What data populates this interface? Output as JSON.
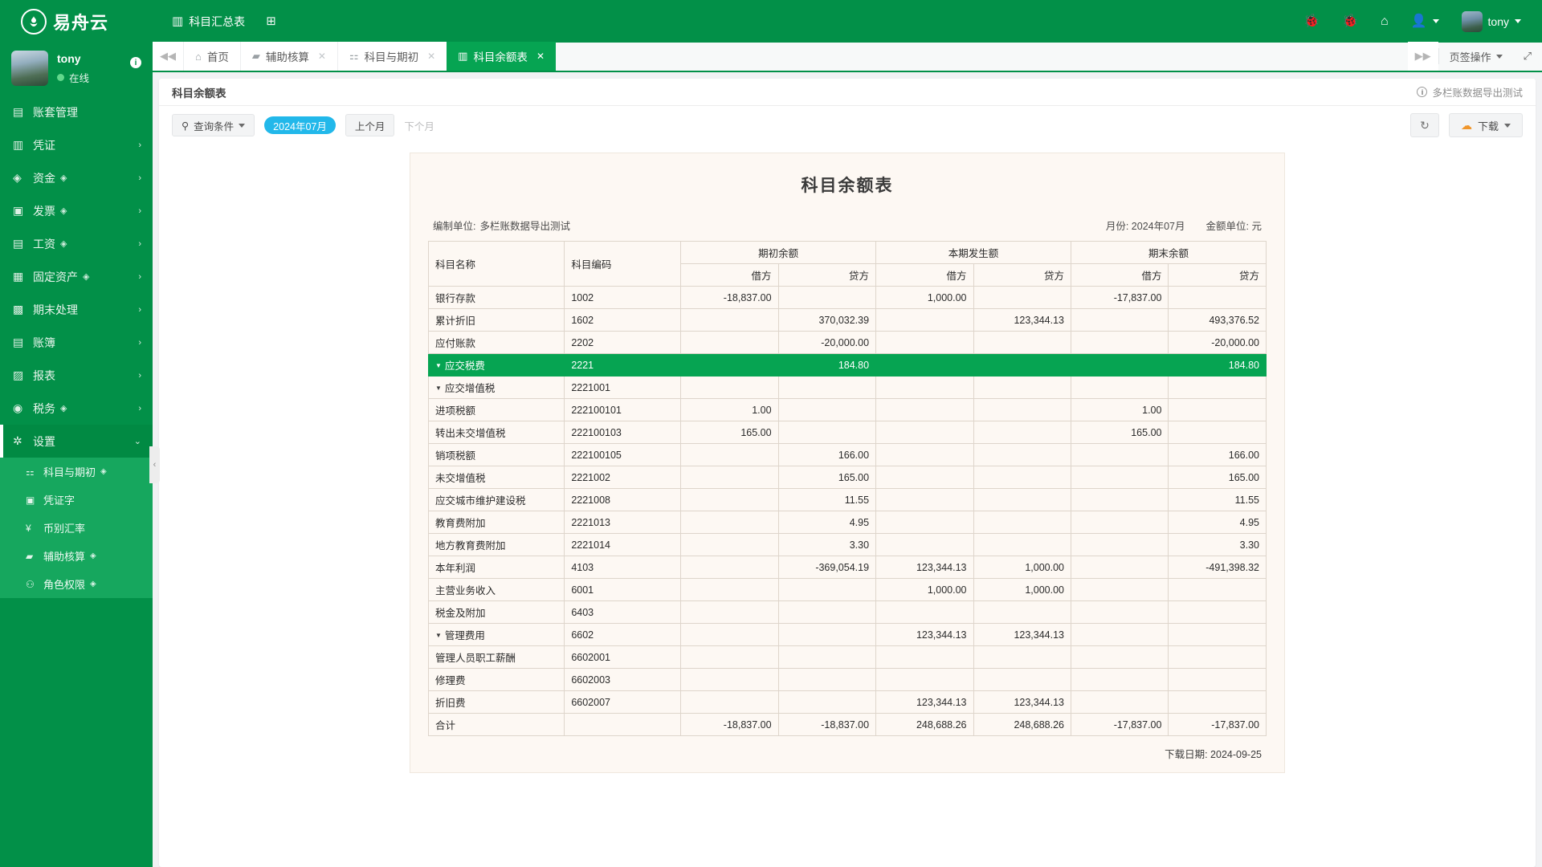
{
  "topbar": {
    "brand_name": "易舟云",
    "brand_logo_icon": "leaf-circle-icon",
    "menu": [
      {
        "label": "科目汇总表",
        "icon": "columns-icon"
      },
      {
        "label": "",
        "icon": "add-square-icon"
      }
    ],
    "icons": [
      "bug-icon",
      "bug-icon",
      "home-icon",
      "user-switch-icon"
    ],
    "user_name": "tony",
    "avatar_icon": "avatar"
  },
  "sidebar": {
    "user": {
      "name": "tony",
      "status": "在线",
      "info_badge": "i"
    },
    "items": [
      {
        "label": "账套管理",
        "icon": "account-book-icon",
        "chevron": "",
        "gem": false,
        "active": false
      },
      {
        "label": "凭证",
        "icon": "voucher-icon",
        "chevron": "›",
        "gem": false,
        "active": false
      },
      {
        "label": "资金",
        "icon": "funds-icon",
        "chevron": "›",
        "gem": true,
        "active": false
      },
      {
        "label": "发票",
        "icon": "invoice-icon",
        "chevron": "›",
        "gem": true,
        "active": false
      },
      {
        "label": "工资",
        "icon": "salary-icon",
        "chevron": "›",
        "gem": true,
        "active": false
      },
      {
        "label": "固定资产",
        "icon": "asset-icon",
        "chevron": "›",
        "gem": true,
        "active": false
      },
      {
        "label": "期末处理",
        "icon": "calendar-icon",
        "chevron": "›",
        "gem": false,
        "active": false
      },
      {
        "label": "账簿",
        "icon": "ledger-icon",
        "chevron": "›",
        "gem": false,
        "active": false
      },
      {
        "label": "报表",
        "icon": "chart-icon",
        "chevron": "›",
        "gem": false,
        "active": false
      },
      {
        "label": "税务",
        "icon": "tax-icon",
        "chevron": "›",
        "gem": true,
        "active": false
      },
      {
        "label": "设置",
        "icon": "gear-icon",
        "chevron": "⌄",
        "gem": false,
        "active": true
      }
    ],
    "submenu": [
      {
        "label": "科目与期初",
        "icon": "subject-icon",
        "gem": true
      },
      {
        "label": "凭证字",
        "icon": "voucher-word-icon",
        "gem": false
      },
      {
        "label": "币别汇率",
        "icon": "yen-icon",
        "gem": false
      },
      {
        "label": "辅助核算",
        "icon": "folder-icon",
        "gem": true
      },
      {
        "label": "角色权限",
        "icon": "roles-icon",
        "gem": true
      }
    ],
    "collapse_handle_icon": "chevron-left-icon"
  },
  "tabstrip": {
    "prev_icon": "double-chevron-left-icon",
    "next_icon": "double-chevron-right-icon",
    "tabs": [
      {
        "label": "首页",
        "icon": "home-icon",
        "closable": false,
        "active": false
      },
      {
        "label": "辅助核算",
        "icon": "folder-icon",
        "closable": true,
        "active": false
      },
      {
        "label": "科目与期初",
        "icon": "subject-icon",
        "closable": true,
        "active": false
      },
      {
        "label": "科目余额表",
        "icon": "columns-icon",
        "closable": true,
        "active": true
      }
    ],
    "tab_action_label": "页签操作",
    "fullscreen_icon": "fullscreen-icon"
  },
  "panel": {
    "title": "科目余额表",
    "org_note": "多栏账数据导出测试",
    "info_icon": "info-icon"
  },
  "toolbar": {
    "query_label": "查询条件",
    "query_icon": "search-icon",
    "period_pill": "2024年07月",
    "prev_month": "上个月",
    "next_month": "下个月",
    "refresh_icon": "refresh-icon",
    "download_label": "下载",
    "download_icon": "cloud-download-icon"
  },
  "report": {
    "title": "科目余额表",
    "org_label": "编制单位:",
    "org_value": "多栏账数据导出测试",
    "period_label": "月份:",
    "period_value": "2024年07月",
    "unit_label": "金额单位:",
    "unit_value": "元",
    "download_date_label": "下载日期:",
    "download_date_value": "2024-09-25",
    "group_headers": [
      "科目名称",
      "科目编码",
      "期初余额",
      "本期发生额",
      "期末余额"
    ],
    "sub_headers": [
      "借方",
      "贷方",
      "借方",
      "贷方",
      "借方",
      "贷方"
    ],
    "rows": [
      {
        "name": "银行存款",
        "code": "1002",
        "indent": 0,
        "expandable": false,
        "highlight": false,
        "cells": [
          "-18,837.00",
          "",
          "1,000.00",
          "",
          "-17,837.00",
          ""
        ],
        "neg": [
          true,
          false,
          false,
          false,
          true,
          false
        ]
      },
      {
        "name": "累计折旧",
        "code": "1602",
        "indent": 0,
        "expandable": false,
        "highlight": false,
        "cells": [
          "",
          "370,032.39",
          "",
          "123,344.13",
          "",
          "493,376.52"
        ],
        "neg": [
          false,
          false,
          false,
          false,
          false,
          false
        ]
      },
      {
        "name": "应付账款",
        "code": "2202",
        "indent": 0,
        "expandable": false,
        "highlight": false,
        "cells": [
          "",
          "-20,000.00",
          "",
          "",
          "",
          "-20,000.00"
        ],
        "neg": [
          false,
          true,
          false,
          false,
          false,
          true
        ]
      },
      {
        "name": "应交税费",
        "code": "2221",
        "indent": 0,
        "expandable": true,
        "highlight": true,
        "cells": [
          "",
          "184.80",
          "",
          "",
          "",
          "184.80"
        ],
        "neg": [
          false,
          false,
          false,
          false,
          false,
          false
        ]
      },
      {
        "name": "应交增值税",
        "code": "2221001",
        "indent": 1,
        "expandable": true,
        "highlight": false,
        "cells": [
          "",
          "",
          "",
          "",
          "",
          ""
        ],
        "neg": [
          false,
          false,
          false,
          false,
          false,
          false
        ]
      },
      {
        "name": "进项税额",
        "code": "222100101",
        "indent": 2,
        "expandable": false,
        "highlight": false,
        "cells": [
          "1.00",
          "",
          "",
          "",
          "1.00",
          ""
        ],
        "neg": [
          false,
          false,
          false,
          false,
          false,
          false
        ]
      },
      {
        "name": "转出未交增值税",
        "code": "222100103",
        "indent": 2,
        "expandable": false,
        "highlight": false,
        "cells": [
          "165.00",
          "",
          "",
          "",
          "165.00",
          ""
        ],
        "neg": [
          false,
          false,
          false,
          false,
          false,
          false
        ]
      },
      {
        "name": "销项税额",
        "code": "222100105",
        "indent": 2,
        "expandable": false,
        "highlight": false,
        "cells": [
          "",
          "166.00",
          "",
          "",
          "",
          "166.00"
        ],
        "neg": [
          false,
          false,
          false,
          false,
          false,
          false
        ]
      },
      {
        "name": "未交增值税",
        "code": "2221002",
        "indent": 1,
        "expandable": false,
        "highlight": false,
        "cells": [
          "",
          "165.00",
          "",
          "",
          "",
          "165.00"
        ],
        "neg": [
          false,
          false,
          false,
          false,
          false,
          false
        ]
      },
      {
        "name": "应交城市维护建设税",
        "code": "2221008",
        "indent": 1,
        "expandable": false,
        "highlight": false,
        "cells": [
          "",
          "11.55",
          "",
          "",
          "",
          "11.55"
        ],
        "neg": [
          false,
          false,
          false,
          false,
          false,
          false
        ]
      },
      {
        "name": "教育费附加",
        "code": "2221013",
        "indent": 1,
        "expandable": false,
        "highlight": false,
        "cells": [
          "",
          "4.95",
          "",
          "",
          "",
          "4.95"
        ],
        "neg": [
          false,
          false,
          false,
          false,
          false,
          false
        ]
      },
      {
        "name": "地方教育费附加",
        "code": "2221014",
        "indent": 1,
        "expandable": false,
        "highlight": false,
        "cells": [
          "",
          "3.30",
          "",
          "",
          "",
          "3.30"
        ],
        "neg": [
          false,
          false,
          false,
          false,
          false,
          false
        ]
      },
      {
        "name": "本年利润",
        "code": "4103",
        "indent": 0,
        "expandable": false,
        "highlight": false,
        "cells": [
          "",
          "-369,054.19",
          "123,344.13",
          "1,000.00",
          "",
          "-491,398.32"
        ],
        "neg": [
          false,
          true,
          false,
          false,
          false,
          true
        ]
      },
      {
        "name": "主营业务收入",
        "code": "6001",
        "indent": 0,
        "expandable": false,
        "highlight": false,
        "cells": [
          "",
          "",
          "1,000.00",
          "1,000.00",
          "",
          ""
        ],
        "neg": [
          false,
          false,
          false,
          false,
          false,
          false
        ]
      },
      {
        "name": "税金及附加",
        "code": "6403",
        "indent": 0,
        "expandable": false,
        "highlight": false,
        "cells": [
          "",
          "",
          "",
          "",
          "",
          ""
        ],
        "neg": [
          false,
          false,
          false,
          false,
          false,
          false
        ]
      },
      {
        "name": "管理费用",
        "code": "6602",
        "indent": 0,
        "expandable": true,
        "highlight": false,
        "cells": [
          "",
          "",
          "123,344.13",
          "123,344.13",
          "",
          ""
        ],
        "neg": [
          false,
          false,
          false,
          false,
          false,
          false
        ]
      },
      {
        "name": "管理人员职工薪酬",
        "code": "6602001",
        "indent": 1,
        "expandable": false,
        "highlight": false,
        "cells": [
          "",
          "",
          "",
          "",
          "",
          ""
        ],
        "neg": [
          false,
          false,
          false,
          false,
          false,
          false
        ]
      },
      {
        "name": "修理费",
        "code": "6602003",
        "indent": 1,
        "expandable": false,
        "highlight": false,
        "cells": [
          "",
          "",
          "",
          "",
          "",
          ""
        ],
        "neg": [
          false,
          false,
          false,
          false,
          false,
          false
        ]
      },
      {
        "name": "折旧费",
        "code": "6602007",
        "indent": 1,
        "expandable": false,
        "highlight": false,
        "cells": [
          "",
          "",
          "123,344.13",
          "123,344.13",
          "",
          ""
        ],
        "neg": [
          false,
          false,
          false,
          false,
          false,
          false
        ]
      }
    ],
    "total_row": {
      "name": "合计",
      "code": "",
      "indent": 0,
      "cells": [
        "-18,837.00",
        "-18,837.00",
        "248,688.26",
        "248,688.26",
        "-17,837.00",
        "-17,837.00"
      ],
      "neg": [
        true,
        true,
        false,
        false,
        true,
        true
      ]
    }
  }
}
